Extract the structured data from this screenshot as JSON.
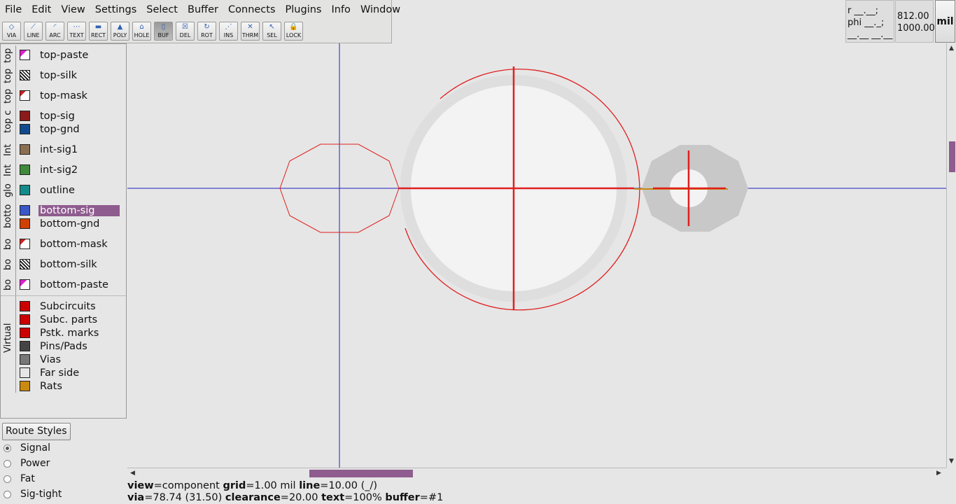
{
  "menu": [
    "File",
    "Edit",
    "View",
    "Settings",
    "Select",
    "Buffer",
    "Connects",
    "Plugins",
    "Info",
    "Window"
  ],
  "tools": [
    {
      "name": "via",
      "label": "VIA",
      "icon": "◇"
    },
    {
      "name": "line",
      "label": "LINE",
      "icon": "⟋"
    },
    {
      "name": "arc",
      "label": "ARC",
      "icon": "◜"
    },
    {
      "name": "text",
      "label": "TEXT",
      "icon": "⋯"
    },
    {
      "name": "rect",
      "label": "RECT",
      "icon": "▬"
    },
    {
      "name": "poly",
      "label": "POLY",
      "icon": "▲"
    },
    {
      "name": "hole",
      "label": "HOLE",
      "icon": "⌂"
    },
    {
      "name": "buf",
      "label": "BUF",
      "icon": "▯",
      "active": true
    },
    {
      "name": "del",
      "label": "DEL",
      "icon": "☒"
    },
    {
      "name": "rot",
      "label": "ROT",
      "icon": "↻"
    },
    {
      "name": "ins",
      "label": "INS",
      "icon": "⋰"
    },
    {
      "name": "thrm",
      "label": "THRM",
      "icon": "✕"
    },
    {
      "name": "sel",
      "label": "SEL",
      "icon": "↖"
    },
    {
      "name": "lock",
      "label": "LOCK",
      "icon": "🔒"
    }
  ],
  "status_corner": {
    "r": "r __.__;",
    "phi": "phi __._;",
    "dash": "__.__ __.__",
    "x": "812.00",
    "y": "1000.00",
    "unit": "mil"
  },
  "layer_groups": [
    {
      "tab": "top"
    },
    {
      "tab": "top"
    },
    {
      "tab": "top"
    },
    {
      "tab": "top c"
    },
    {
      "tab": "Int"
    },
    {
      "tab": "Int"
    },
    {
      "tab": "glo"
    },
    {
      "tab": "botto"
    },
    {
      "tab": "bo"
    },
    {
      "tab": "bo"
    },
    {
      "tab": "bo"
    },
    {
      "tab": "Virtual"
    }
  ],
  "layers": [
    {
      "label": "top-paste",
      "color": "#e020d0",
      "style": "pink"
    },
    {
      "label": "top-silk",
      "color": "#111111",
      "style": "hatch"
    },
    {
      "label": "top-mask",
      "color": "#d02020",
      "style": "mask"
    },
    {
      "label": "top-sig",
      "color": "#8b1a1a"
    },
    {
      "label": "top-gnd",
      "color": "#104a8c"
    },
    {
      "label": "int-sig1",
      "color": "#8b6f52"
    },
    {
      "label": "int-sig2",
      "color": "#3f8a3c"
    },
    {
      "label": "outline",
      "color": "#138b8b"
    },
    {
      "label": "bottom-sig",
      "color": "#3a56c8",
      "selected": true
    },
    {
      "label": "bottom-gnd",
      "color": "#d04000"
    },
    {
      "label": "bottom-mask",
      "color": "#d02020",
      "style": "mask"
    },
    {
      "label": "bottom-silk",
      "color": "#111111",
      "style": "hatch"
    },
    {
      "label": "bottom-paste",
      "color": "#e020d0",
      "style": "pink"
    }
  ],
  "virtual_layers": [
    {
      "label": "Subcircuits",
      "color": "#cc0000"
    },
    {
      "label": "Subc. parts",
      "color": "#cc0000"
    },
    {
      "label": "Pstk. marks",
      "color": "#cc0000"
    },
    {
      "label": "Pins/Pads",
      "color": "#444444"
    },
    {
      "label": "Vias",
      "color": "#777777"
    },
    {
      "label": "Far side",
      "color": "#e6e6e6"
    },
    {
      "label": "Rats",
      "color": "#c88a10"
    }
  ],
  "route_styles": {
    "button": "Route Styles",
    "items": [
      {
        "label": "Signal",
        "checked": true
      },
      {
        "label": "Power",
        "checked": false
      },
      {
        "label": "Fat",
        "checked": false
      },
      {
        "label": "Sig-tight",
        "checked": false
      }
    ]
  },
  "status": {
    "view_k": "view",
    "view_v": "=component",
    "grid_k": "grid",
    "grid_v": "=1.00 mil",
    "line_k": "line",
    "line_v": "=10.00 (_/)",
    "via_k": "via",
    "via_v": "=78.74 (31.50)",
    "clear_k": "clearance",
    "clear_v": "=20.00",
    "text_k": "text",
    "text_v": "=100%",
    "buf_k": "buffer",
    "buf_v": "=#1"
  },
  "colors": {
    "crosshair": "#2020c0",
    "buffer": "#e02020",
    "pad": "#f3f3f3",
    "pad_ring": "#dedede",
    "via": "#c8c8c8",
    "selection": "#8e5c8e"
  }
}
